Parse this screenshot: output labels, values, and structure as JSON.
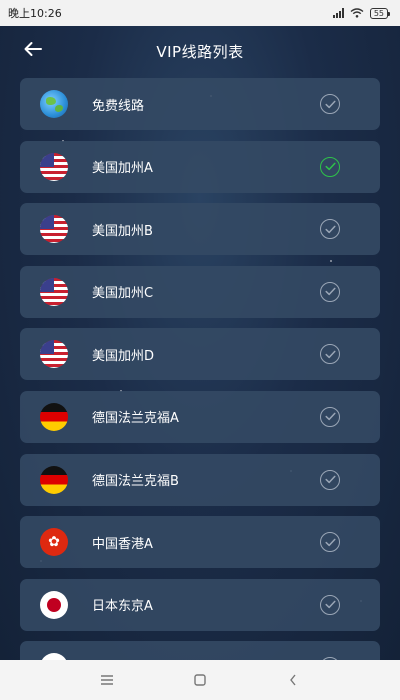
{
  "status_bar": {
    "time": "晚上10:26",
    "battery": "55"
  },
  "header": {
    "title": "VIP线路列表"
  },
  "routes": [
    {
      "name": "免费线路",
      "flag": "globe",
      "selected": false
    },
    {
      "name": "美国加州A",
      "flag": "us",
      "selected": true
    },
    {
      "name": "美国加州B",
      "flag": "us",
      "selected": false
    },
    {
      "name": "美国加州C",
      "flag": "us",
      "selected": false
    },
    {
      "name": "美国加州D",
      "flag": "us",
      "selected": false
    },
    {
      "name": "德国法兰克福A",
      "flag": "de",
      "selected": false
    },
    {
      "name": "德国法兰克福B",
      "flag": "de",
      "selected": false
    },
    {
      "name": "中国香港A",
      "flag": "hk",
      "selected": false
    },
    {
      "name": "日本东京A",
      "flag": "jp",
      "selected": false
    },
    {
      "name": "",
      "flag": "jp",
      "selected": false
    }
  ],
  "colors": {
    "accent_selected": "#2ec24a",
    "unselected_check": "#9aa6b6",
    "card_bg": "#344a64",
    "page_bg": "#1b2c48"
  },
  "icons": {
    "back": "arrow-left-icon",
    "check": "check-circle-icon",
    "nav_menu": "menu-icon",
    "nav_home": "square-icon",
    "nav_back": "chevron-left-icon"
  }
}
